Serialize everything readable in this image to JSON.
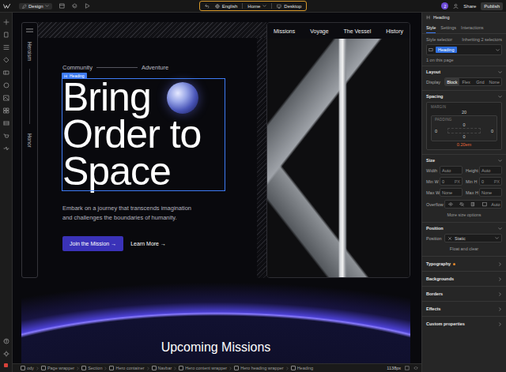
{
  "topbar": {
    "mode": "Design",
    "locale": "English",
    "page": "Home",
    "breakpoint": "Desktop",
    "collaborators": "2",
    "share": "Share",
    "publish": "Publish"
  },
  "canvas": {
    "rail": [
      "Heroism",
      "Honor"
    ],
    "nav": [
      "Missions",
      "Voyage",
      "The Vessel",
      "History"
    ],
    "tags": [
      "Community",
      "Adventure"
    ],
    "selection_badge": "Heading",
    "heading_lines": [
      "Bring",
      "Order to",
      "Space"
    ],
    "body_lines": [
      "Embark on a journey that transcends imagination",
      "and challenges the boundaries of humanity."
    ],
    "primary_button": {
      "label": "Join the Mission",
      "arrow": "→"
    },
    "secondary_button": {
      "label": "Learn More",
      "arrow": "→"
    },
    "section_title": "Upcoming Missions"
  },
  "panel": {
    "title": "Heading",
    "tabs": [
      {
        "label": "Style",
        "selected": true
      },
      {
        "label": "Settings",
        "selected": false
      },
      {
        "label": "Interactions",
        "selected": false
      }
    ],
    "selector": {
      "label": "Style selector",
      "inheriting": "Inheriting 2 selectors",
      "chip": "Heading",
      "count": "1 on this page"
    },
    "layout": {
      "title": "Layout",
      "display_label": "Display",
      "options": [
        {
          "label": "Block",
          "selected": true
        },
        {
          "label": "Flex",
          "selected": false
        },
        {
          "label": "Grid",
          "selected": false
        },
        {
          "label": "None",
          "selected": false
        }
      ]
    },
    "spacing": {
      "title": "Spacing",
      "margin_label": "MARGIN",
      "padding_label": "PADDING",
      "margin_top": "20",
      "margin_bottom": "0.20em",
      "padding_top": "0",
      "padding_left": "0",
      "padding_right": "0",
      "padding_bottom": "0"
    },
    "size": {
      "title": "Size",
      "fields": [
        {
          "label": "Width",
          "value": "Auto",
          "unit": ""
        },
        {
          "label": "Height",
          "value": "Auto",
          "unit": ""
        },
        {
          "label": "Min W",
          "value": "0",
          "unit": "PX"
        },
        {
          "label": "Min H",
          "value": "0",
          "unit": "PX"
        },
        {
          "label": "Max W",
          "value": "None",
          "unit": ""
        },
        {
          "label": "Max H",
          "value": "None",
          "unit": ""
        }
      ],
      "overflow_label": "Overflow",
      "overflow_value": "Auto",
      "more": "More size options"
    },
    "position": {
      "title": "Position",
      "label": "Position",
      "value": "Static",
      "clear": "Float and clear"
    },
    "sections": [
      {
        "label": "Typography",
        "modified": true
      },
      {
        "label": "Backgrounds",
        "modified": false
      },
      {
        "label": "Borders",
        "modified": false
      },
      {
        "label": "Effects",
        "modified": false
      },
      {
        "label": "Custom properties",
        "modified": false
      }
    ]
  },
  "status_bar": {
    "breadcrumbs": [
      "ody",
      "Page wrapper",
      "Section",
      "Hero container",
      "Navbar",
      "Hero content wrapper",
      "Hero heading wrapper",
      "Heading"
    ],
    "width": "1138px"
  }
}
